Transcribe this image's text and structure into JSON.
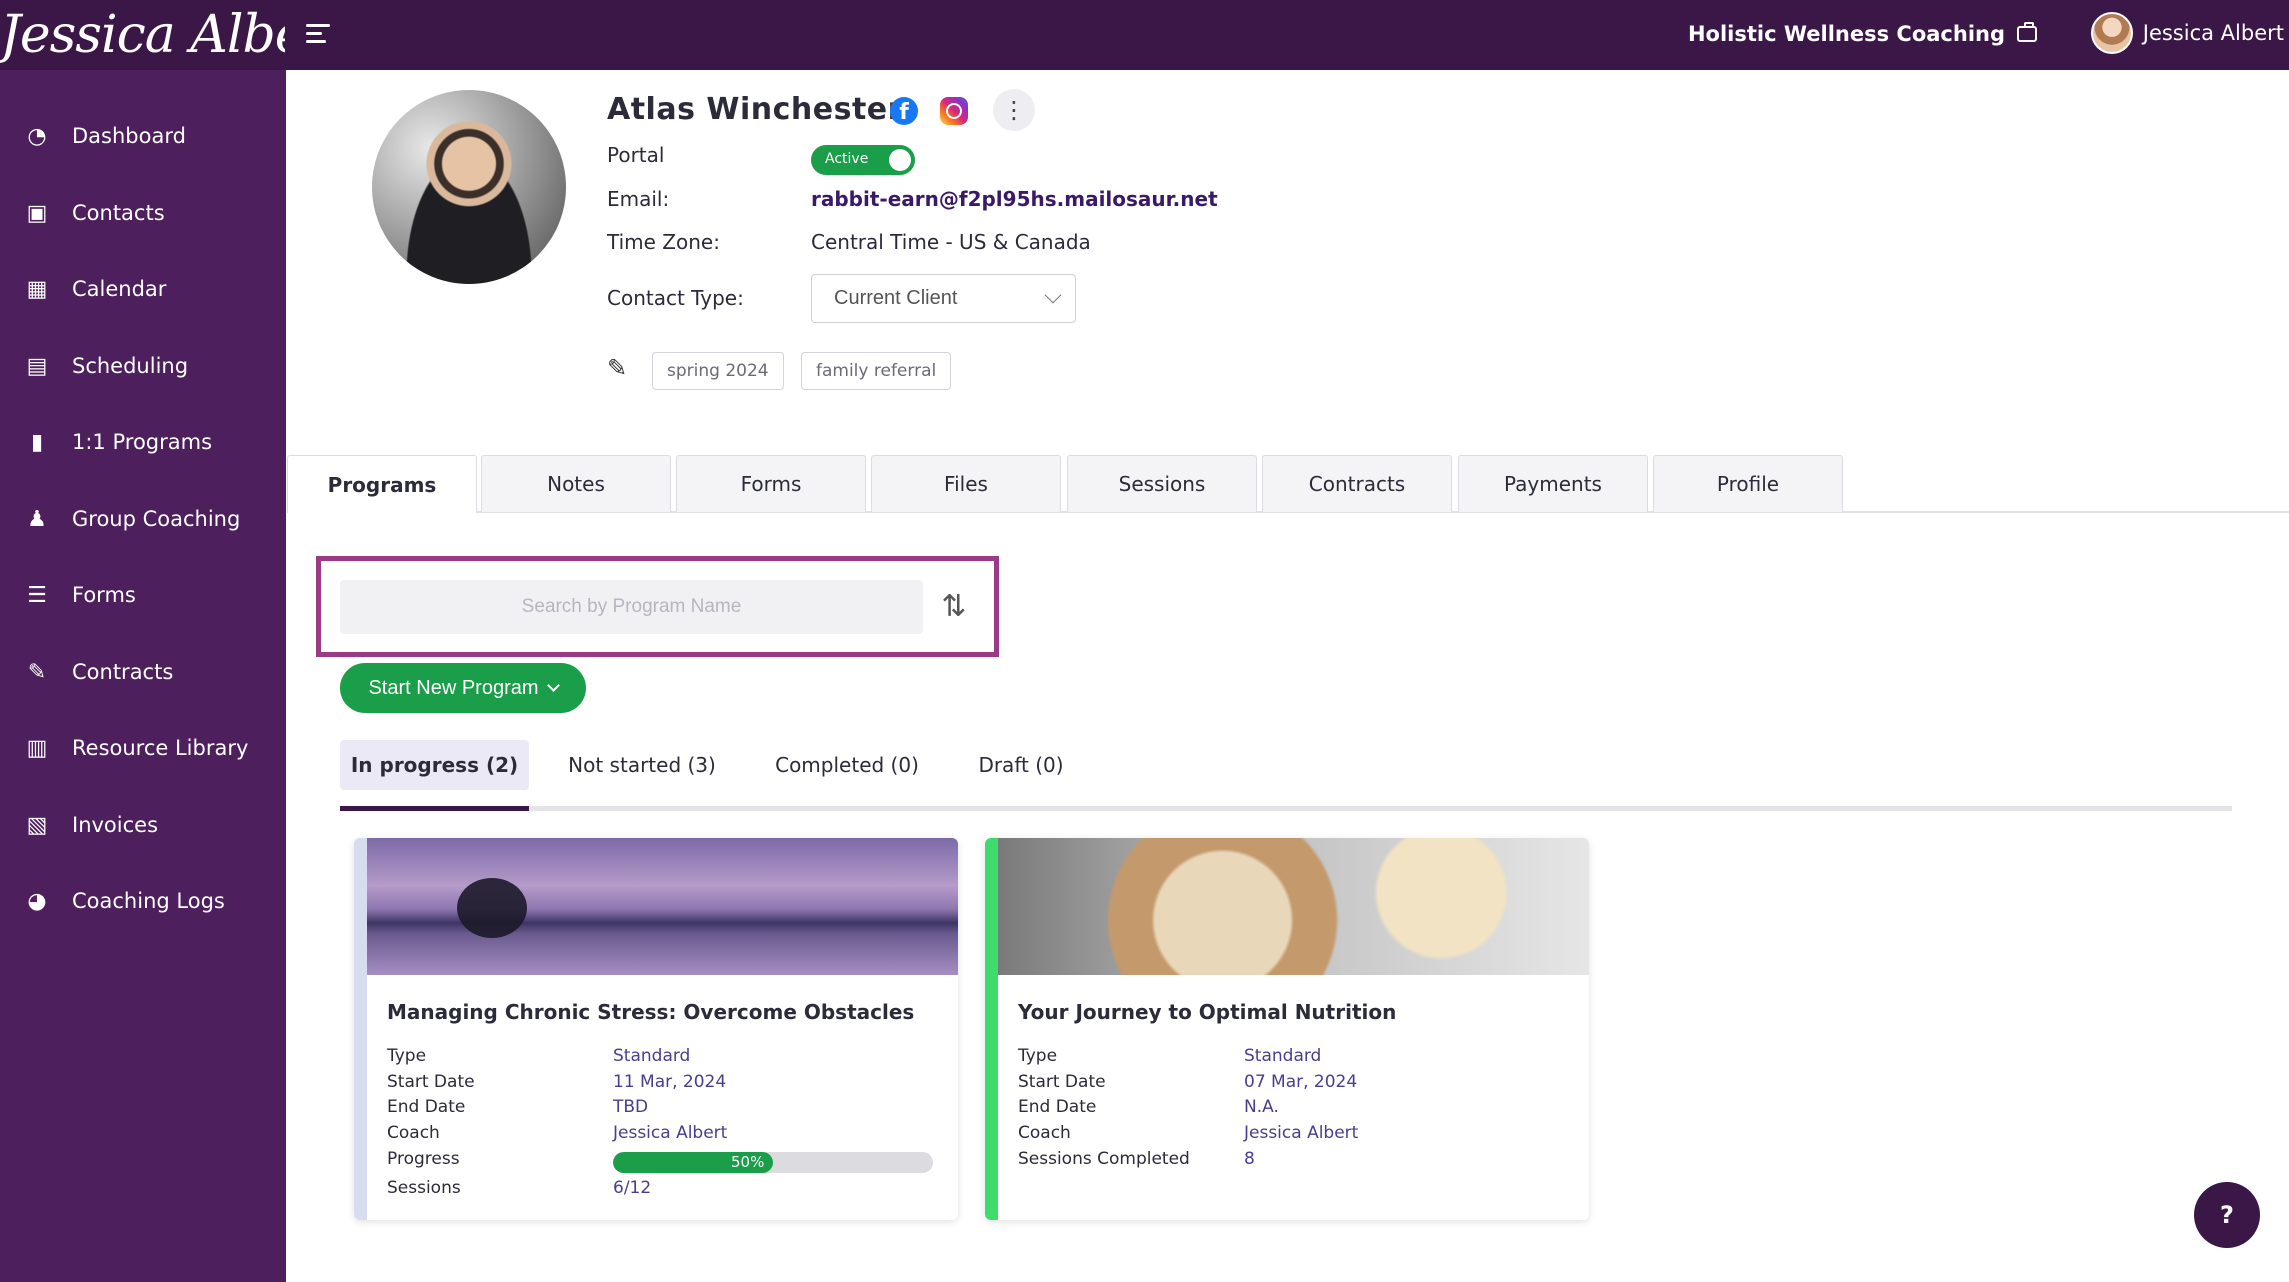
{
  "brand": {
    "logo_text": "Jessica Albert",
    "business_name": "Holistic Wellness Coaching",
    "user_name": "Jessica Albert"
  },
  "sidebar": {
    "items": [
      {
        "label": "Dashboard",
        "icon": "dashboard-icon"
      },
      {
        "label": "Contacts",
        "icon": "contacts-icon"
      },
      {
        "label": "Calendar",
        "icon": "calendar-icon"
      },
      {
        "label": "Scheduling",
        "icon": "scheduling-icon"
      },
      {
        "label": "1:1 Programs",
        "icon": "book-icon"
      },
      {
        "label": "Group Coaching",
        "icon": "group-icon"
      },
      {
        "label": "Forms",
        "icon": "forms-icon"
      },
      {
        "label": "Contracts",
        "icon": "contract-icon"
      },
      {
        "label": "Resource Library",
        "icon": "library-icon"
      },
      {
        "label": "Invoices",
        "icon": "invoice-icon"
      },
      {
        "label": "Coaching Logs",
        "icon": "clock-icon"
      }
    ]
  },
  "contact": {
    "name": "Atlas Winchester",
    "portal_label": "Portal",
    "portal_status": "Active",
    "email_label": "Email:",
    "email": "rabbit-earn@f2pl95hs.mailosaur.net",
    "timezone_label": "Time Zone:",
    "timezone": "Central Time - US & Canada",
    "contact_type_label": "Contact Type:",
    "contact_type": "Current Client",
    "tags": [
      "spring 2024",
      "family referral"
    ]
  },
  "tabs": [
    "Programs",
    "Notes",
    "Forms",
    "Files",
    "Sessions",
    "Contracts",
    "Payments",
    "Profile"
  ],
  "search": {
    "placeholder": "Search by Program Name"
  },
  "start_button": "Start New Program",
  "subtabs": [
    "In progress (2)",
    "Not started (3)",
    "Completed (0)",
    "Draft (0)"
  ],
  "cards": [
    {
      "title": "Managing Chronic Stress: Overcome Obstacles",
      "accent": "#d7dcef",
      "type_label": "Type",
      "type": "Standard",
      "start_label": "Start Date",
      "start": "11 Mar, 2024",
      "end_label": "End Date",
      "end": "TBD",
      "coach_label": "Coach",
      "coach": "Jessica Albert",
      "progress_label": "Progress",
      "progress_text": "50%",
      "progress_value": 0.5,
      "sessions_label": "Sessions",
      "sessions": "6/12"
    },
    {
      "title": "Your Journey to Optimal Nutrition",
      "accent": "#3ddc6b",
      "type_label": "Type",
      "type": "Standard",
      "start_label": "Start Date",
      "start": "07 Mar, 2024",
      "end_label": "End Date",
      "end": "N.A.",
      "coach_label": "Coach",
      "coach": "Jessica Albert",
      "sessions_completed_label": "Sessions Completed",
      "sessions_completed": "8"
    }
  ],
  "help_label": "?"
}
